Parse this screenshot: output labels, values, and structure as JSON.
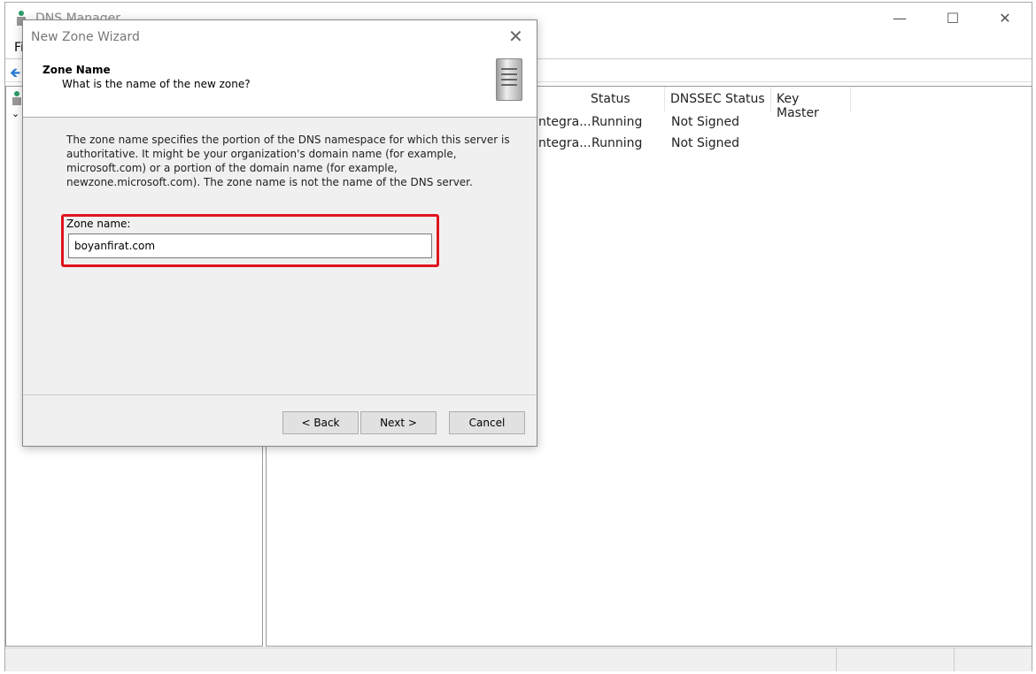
{
  "window": {
    "title": "DNS Manager",
    "menu_first": "Fi"
  },
  "list": {
    "columns": [
      "Status",
      "DNSSEC Status",
      "Key Master"
    ],
    "rows": [
      {
        "type": "ntegra...",
        "status": "Running",
        "dnssec": "Not Signed"
      },
      {
        "type": "ntegra...",
        "status": "Running",
        "dnssec": "Not Signed"
      }
    ]
  },
  "dialog": {
    "title": "New Zone Wizard",
    "header_title": "Zone Name",
    "header_subtitle": "What is the name of the new zone?",
    "description": "The zone name specifies the portion of the DNS namespace for which this server is authoritative. It might be your organization's domain name (for example, microsoft.com) or a portion of the domain name (for example, newzone.microsoft.com). The zone name is not the name of the DNS server.",
    "zone_label": "Zone name:",
    "zone_value": "boyanfirat.com",
    "buttons": {
      "back": "< Back",
      "next": "Next >",
      "cancel": "Cancel"
    },
    "highlight_color": "#e0141e"
  }
}
